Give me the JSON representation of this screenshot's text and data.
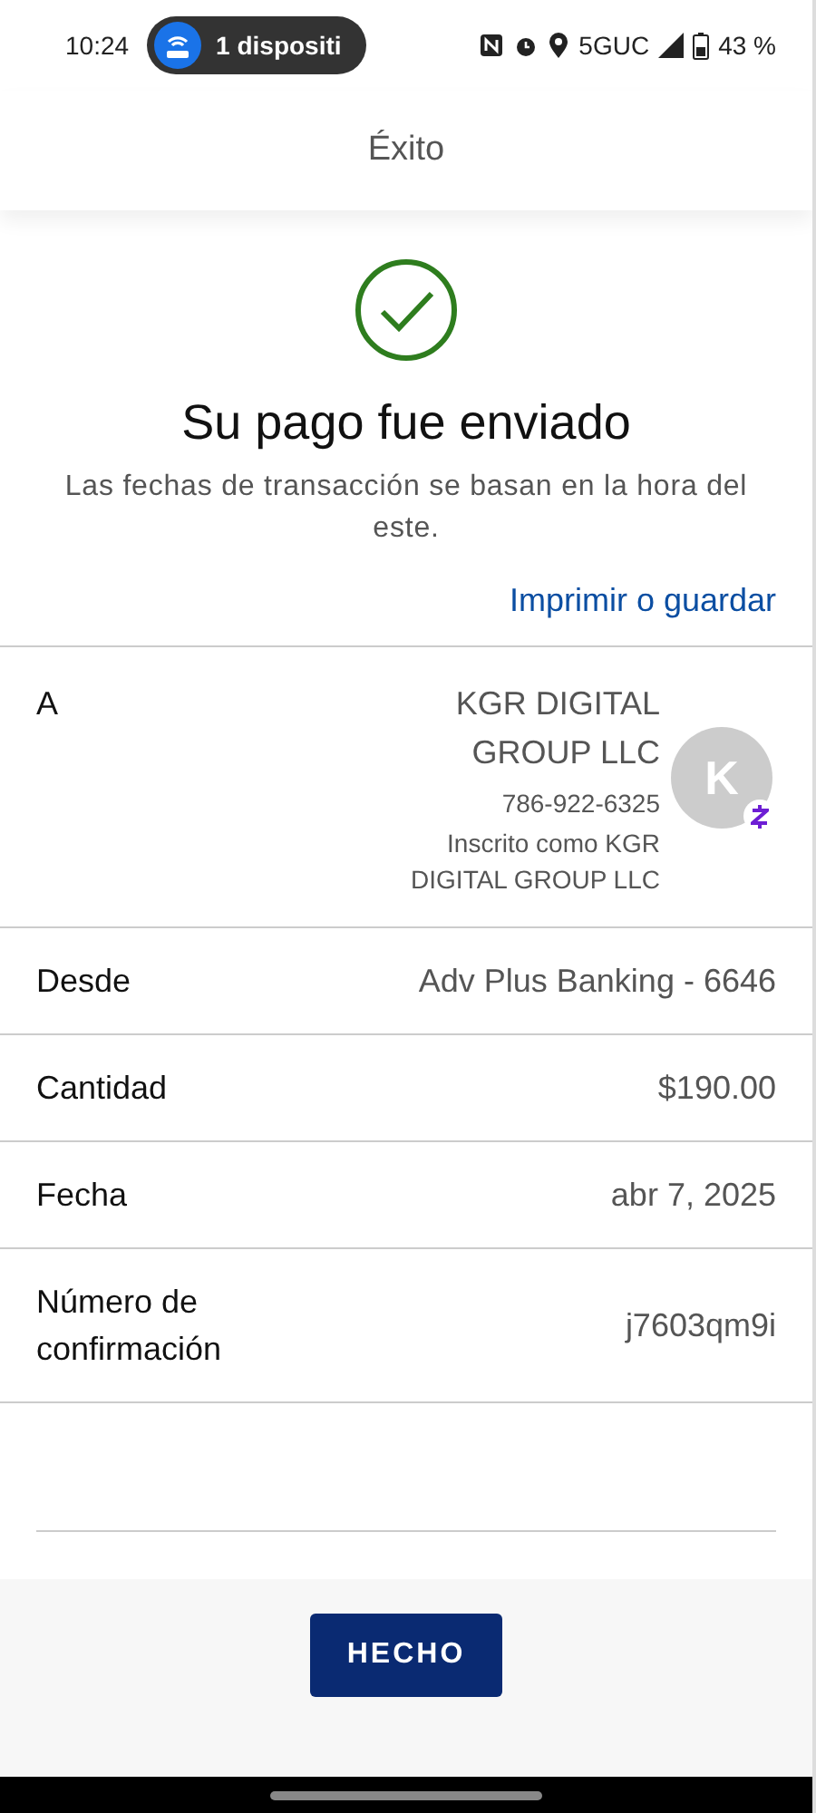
{
  "status_bar": {
    "time": "10:24",
    "notification": "1 dispositi",
    "network": "5GUC",
    "battery": "43 %"
  },
  "header": {
    "title": "Éxito"
  },
  "success": {
    "title": "Su pago fue enviado",
    "subtitle": "Las fechas de transacción se basan en la hora del este.",
    "link": "Imprimir o guardar"
  },
  "details": [
    {
      "kind": "recipient",
      "label": "A",
      "name": "KGR DIGITAL GROUP LLC",
      "phone": "786-922-6325",
      "enrolled": "Inscrito como KGR DIGITAL GROUP LLC",
      "avatar": "K"
    },
    {
      "kind": "plain",
      "label": "Desde",
      "value": "Adv Plus Banking - 6646"
    },
    {
      "kind": "plain",
      "label": "Cantidad",
      "value": "$190.00"
    },
    {
      "kind": "plain",
      "label": "Fecha",
      "value": "abr 7, 2025"
    },
    {
      "kind": "plain",
      "label": "Número de confirmación",
      "value": "j7603qm9i"
    }
  ],
  "button": "HECHO"
}
